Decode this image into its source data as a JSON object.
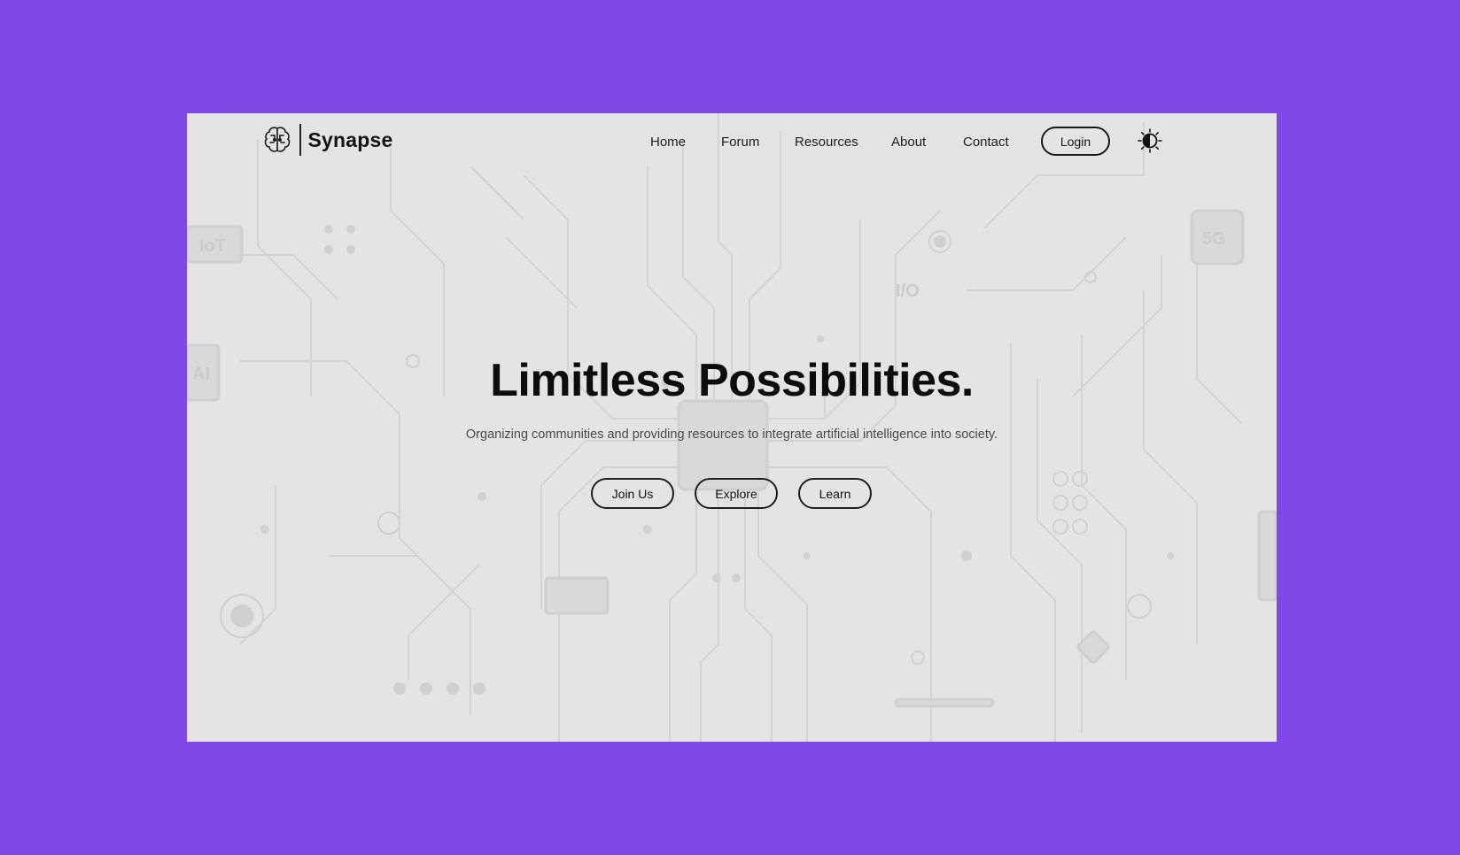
{
  "brand": {
    "name": "Synapse",
    "icon": "brain-icon"
  },
  "nav": {
    "links": [
      "Home",
      "Forum",
      "Resources",
      "About",
      "Contact"
    ],
    "login_label": "Login",
    "theme_icon": "sun-half-icon"
  },
  "hero": {
    "title": "Limitless Possibilities.",
    "subtitle": "Organizing communities and providing resources to integrate artificial intelligence into society.",
    "buttons": [
      "Join Us",
      "Explore",
      "Learn"
    ]
  },
  "background": {
    "chip_labels": [
      "IoT",
      "AI",
      "I/O",
      "5G"
    ]
  },
  "colors": {
    "page_background": "#8048e8",
    "panel_background": "#e4e4e4",
    "text": "#0c0c0c"
  }
}
